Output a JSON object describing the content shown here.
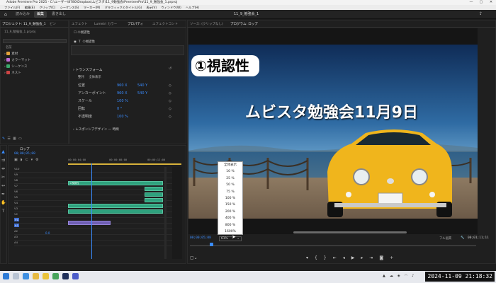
{
  "app": {
    "title": "Adobe Premiere Pro 2025 - C:\\ユーザー\\8780\\Dropbox\\ムビスタ\\11_9勉強会\\PremierePro\\11_9_勉強会_1.prproj",
    "menu": [
      "ファイル(F)",
      "編集(E)",
      "クリップ(C)",
      "シーケンス(S)",
      "マーカー(M)",
      "グラフィックとタイトル(G)",
      "表示(V)",
      "ウィンドウ(W)",
      "ヘルプ(H)"
    ],
    "window_buttons": [
      "—",
      "▢",
      "✕"
    ]
  },
  "workspace": {
    "tabs": [
      "読み込み",
      "編集",
      "書き出し"
    ],
    "active": "編集",
    "sequence_name": "11_9_勉強会_1"
  },
  "project_panel": {
    "tabs": [
      "プロジェクト: 11_9_勉強会_1",
      "ビン"
    ],
    "file": "11_9_勉強会_1.prproj",
    "column": "名前",
    "items": [
      {
        "name": "素材",
        "color": "#e2a23a"
      },
      {
        "name": "カラーマット",
        "color": "#c26bd6"
      },
      {
        "name": "シーケンス",
        "color": "#3aa86b"
      },
      {
        "name": "ネスト",
        "color": "#c44"
      }
    ]
  },
  "effect_controls": {
    "tabs": [
      "エフェクト",
      "Lumetri カラー",
      "プロパティ",
      "エフェクトコント"
    ],
    "clip_name": "①視認性",
    "layer": "①視認性",
    "transform_header": "トランスフォーム",
    "align_label": "整列",
    "align_value": "全体表示",
    "rows": [
      {
        "label": "位置",
        "x": "960 X",
        "y": "540 Y"
      },
      {
        "label": "アンカーポイント",
        "x": "960 X",
        "y": "540 Y"
      },
      {
        "label": "スケール",
        "x": "100 %",
        "y": ""
      },
      {
        "label": "回転",
        "x": "0 °",
        "y": ""
      },
      {
        "label": "不透明度",
        "x": "100 %",
        "y": ""
      }
    ],
    "responsive": "レスポンシブデザイン — 時間"
  },
  "program": {
    "tabs": [
      "ソース: (クリップなし)",
      "プログラム: ロップ"
    ],
    "badge_text": "①視認性",
    "headline": "ムビスタ勉強会11月9日",
    "timecode_left": "00;00;05;08",
    "zoom_value": "61%",
    "fit_label": "フル画質",
    "timecode_right": "00;01;11;11"
  },
  "zoom_menu": [
    "全体表示",
    "10 %",
    "25 %",
    "50 %",
    "75 %",
    "100 %",
    "150 %",
    "200 %",
    "400 %",
    "800 %",
    "1600%"
  ],
  "timeline": {
    "sequence_tab": "ロップ",
    "timecode": "00;00;05;08",
    "ruler": [
      "00;00;04;00",
      "00;00;08;00",
      "00;00;12;00"
    ],
    "tracks": [
      "V10",
      "V9",
      "V8",
      "V7",
      "V6",
      "V5",
      "V4",
      "V3",
      "V2",
      "V1",
      "A1",
      "A2",
      "A3",
      "A4"
    ],
    "clip_label": "①視認性",
    "footer_value": "0.0"
  },
  "taskbar": {
    "clock": "2024-11-09 21:18:32"
  }
}
